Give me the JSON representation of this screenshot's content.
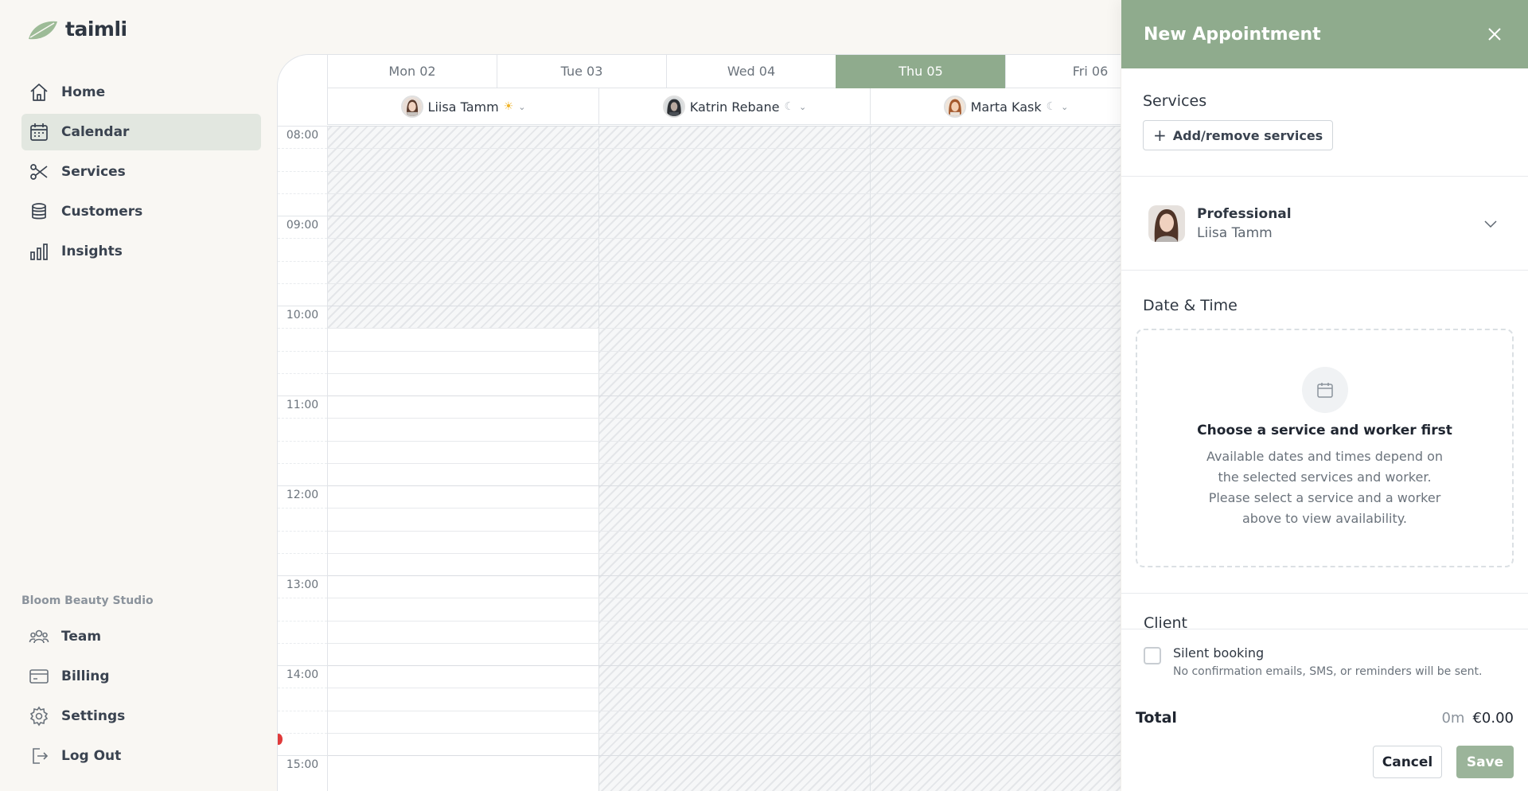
{
  "app": {
    "name": "taimli",
    "accent": "#8fab8d"
  },
  "sidebar": {
    "items": [
      {
        "label": "Home",
        "icon": "home-icon"
      },
      {
        "label": "Calendar",
        "icon": "calendar-icon",
        "active": true
      },
      {
        "label": "Services",
        "icon": "scissors-icon"
      },
      {
        "label": "Customers",
        "icon": "database-icon"
      },
      {
        "label": "Insights",
        "icon": "bar-chart-icon"
      }
    ],
    "studio_name": "Bloom Beauty Studio",
    "bottom_items": [
      {
        "label": "Team",
        "icon": "team-icon"
      },
      {
        "label": "Billing",
        "icon": "credit-card-icon"
      },
      {
        "label": "Settings",
        "icon": "gear-icon"
      },
      {
        "label": "Log Out",
        "icon": "logout-icon"
      }
    ]
  },
  "calendar": {
    "days": [
      {
        "label": "Mon 02"
      },
      {
        "label": "Tue 03"
      },
      {
        "label": "Wed 04"
      },
      {
        "label": "Thu 05",
        "active": true
      },
      {
        "label": "Fri 06"
      }
    ],
    "workers": [
      {
        "name": "Liisa Tamm",
        "status_icon": "☀",
        "status_color": "#f0b429"
      },
      {
        "name": "Katrin Rebane",
        "status_icon": "☾",
        "status_color": "#b8bec5"
      },
      {
        "name": "Marta Kask",
        "status_icon": "☾",
        "status_color": "#b8bec5"
      }
    ],
    "times": [
      "08:00",
      "09:00",
      "10:00",
      "11:00",
      "12:00",
      "13:00",
      "14:00",
      "15:00"
    ],
    "status_colors": {
      "now_line": "#e03a3a"
    }
  },
  "panel": {
    "title": "New Appointment",
    "services": {
      "title": "Services",
      "add_label": "Add/remove services"
    },
    "professional": {
      "label": "Professional",
      "name": "Liisa Tamm"
    },
    "datetime": {
      "title": "Date & Time",
      "heading": "Choose a service and worker first",
      "body": "Available dates and times depend on the selected services and worker. Please select a service and a worker above to view availability."
    },
    "client": {
      "title": "Client"
    },
    "silent": {
      "label": "Silent booking",
      "sub": "No confirmation emails, SMS, or reminders will be sent."
    },
    "total": {
      "label": "Total",
      "duration": "0m",
      "price": "€0.00"
    },
    "buttons": {
      "cancel": "Cancel",
      "save": "Save"
    }
  }
}
